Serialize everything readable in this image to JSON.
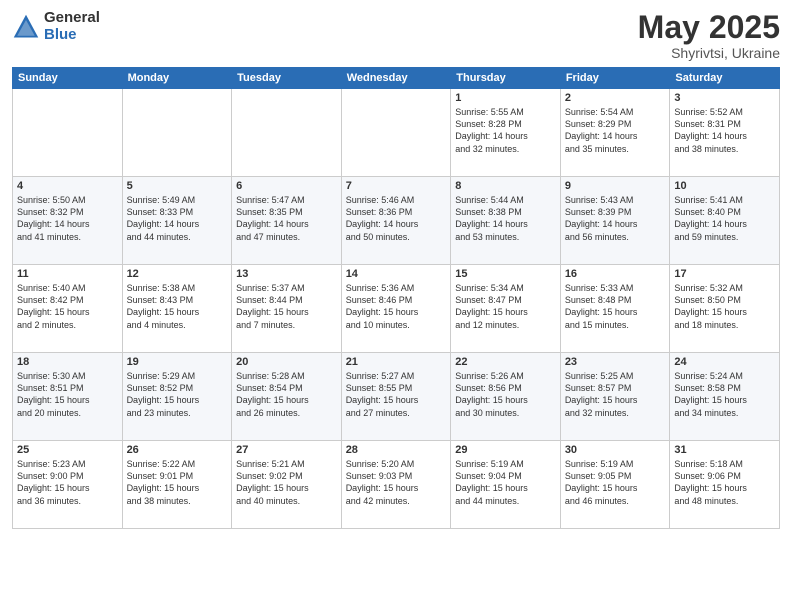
{
  "logo": {
    "general": "General",
    "blue": "Blue"
  },
  "title": {
    "month": "May 2025",
    "location": "Shyrivtsi, Ukraine"
  },
  "headers": [
    "Sunday",
    "Monday",
    "Tuesday",
    "Wednesday",
    "Thursday",
    "Friday",
    "Saturday"
  ],
  "weeks": [
    [
      {
        "day": "",
        "info": ""
      },
      {
        "day": "",
        "info": ""
      },
      {
        "day": "",
        "info": ""
      },
      {
        "day": "",
        "info": ""
      },
      {
        "day": "1",
        "info": "Sunrise: 5:55 AM\nSunset: 8:28 PM\nDaylight: 14 hours\nand 32 minutes."
      },
      {
        "day": "2",
        "info": "Sunrise: 5:54 AM\nSunset: 8:29 PM\nDaylight: 14 hours\nand 35 minutes."
      },
      {
        "day": "3",
        "info": "Sunrise: 5:52 AM\nSunset: 8:31 PM\nDaylight: 14 hours\nand 38 minutes."
      }
    ],
    [
      {
        "day": "4",
        "info": "Sunrise: 5:50 AM\nSunset: 8:32 PM\nDaylight: 14 hours\nand 41 minutes."
      },
      {
        "day": "5",
        "info": "Sunrise: 5:49 AM\nSunset: 8:33 PM\nDaylight: 14 hours\nand 44 minutes."
      },
      {
        "day": "6",
        "info": "Sunrise: 5:47 AM\nSunset: 8:35 PM\nDaylight: 14 hours\nand 47 minutes."
      },
      {
        "day": "7",
        "info": "Sunrise: 5:46 AM\nSunset: 8:36 PM\nDaylight: 14 hours\nand 50 minutes."
      },
      {
        "day": "8",
        "info": "Sunrise: 5:44 AM\nSunset: 8:38 PM\nDaylight: 14 hours\nand 53 minutes."
      },
      {
        "day": "9",
        "info": "Sunrise: 5:43 AM\nSunset: 8:39 PM\nDaylight: 14 hours\nand 56 minutes."
      },
      {
        "day": "10",
        "info": "Sunrise: 5:41 AM\nSunset: 8:40 PM\nDaylight: 14 hours\nand 59 minutes."
      }
    ],
    [
      {
        "day": "11",
        "info": "Sunrise: 5:40 AM\nSunset: 8:42 PM\nDaylight: 15 hours\nand 2 minutes."
      },
      {
        "day": "12",
        "info": "Sunrise: 5:38 AM\nSunset: 8:43 PM\nDaylight: 15 hours\nand 4 minutes."
      },
      {
        "day": "13",
        "info": "Sunrise: 5:37 AM\nSunset: 8:44 PM\nDaylight: 15 hours\nand 7 minutes."
      },
      {
        "day": "14",
        "info": "Sunrise: 5:36 AM\nSunset: 8:46 PM\nDaylight: 15 hours\nand 10 minutes."
      },
      {
        "day": "15",
        "info": "Sunrise: 5:34 AM\nSunset: 8:47 PM\nDaylight: 15 hours\nand 12 minutes."
      },
      {
        "day": "16",
        "info": "Sunrise: 5:33 AM\nSunset: 8:48 PM\nDaylight: 15 hours\nand 15 minutes."
      },
      {
        "day": "17",
        "info": "Sunrise: 5:32 AM\nSunset: 8:50 PM\nDaylight: 15 hours\nand 18 minutes."
      }
    ],
    [
      {
        "day": "18",
        "info": "Sunrise: 5:30 AM\nSunset: 8:51 PM\nDaylight: 15 hours\nand 20 minutes."
      },
      {
        "day": "19",
        "info": "Sunrise: 5:29 AM\nSunset: 8:52 PM\nDaylight: 15 hours\nand 23 minutes."
      },
      {
        "day": "20",
        "info": "Sunrise: 5:28 AM\nSunset: 8:54 PM\nDaylight: 15 hours\nand 26 minutes."
      },
      {
        "day": "21",
        "info": "Sunrise: 5:27 AM\nSunset: 8:55 PM\nDaylight: 15 hours\nand 27 minutes."
      },
      {
        "day": "22",
        "info": "Sunrise: 5:26 AM\nSunset: 8:56 PM\nDaylight: 15 hours\nand 30 minutes."
      },
      {
        "day": "23",
        "info": "Sunrise: 5:25 AM\nSunset: 8:57 PM\nDaylight: 15 hours\nand 32 minutes."
      },
      {
        "day": "24",
        "info": "Sunrise: 5:24 AM\nSunset: 8:58 PM\nDaylight: 15 hours\nand 34 minutes."
      }
    ],
    [
      {
        "day": "25",
        "info": "Sunrise: 5:23 AM\nSunset: 9:00 PM\nDaylight: 15 hours\nand 36 minutes."
      },
      {
        "day": "26",
        "info": "Sunrise: 5:22 AM\nSunset: 9:01 PM\nDaylight: 15 hours\nand 38 minutes."
      },
      {
        "day": "27",
        "info": "Sunrise: 5:21 AM\nSunset: 9:02 PM\nDaylight: 15 hours\nand 40 minutes."
      },
      {
        "day": "28",
        "info": "Sunrise: 5:20 AM\nSunset: 9:03 PM\nDaylight: 15 hours\nand 42 minutes."
      },
      {
        "day": "29",
        "info": "Sunrise: 5:19 AM\nSunset: 9:04 PM\nDaylight: 15 hours\nand 44 minutes."
      },
      {
        "day": "30",
        "info": "Sunrise: 5:19 AM\nSunset: 9:05 PM\nDaylight: 15 hours\nand 46 minutes."
      },
      {
        "day": "31",
        "info": "Sunrise: 5:18 AM\nSunset: 9:06 PM\nDaylight: 15 hours\nand 48 minutes."
      }
    ]
  ]
}
